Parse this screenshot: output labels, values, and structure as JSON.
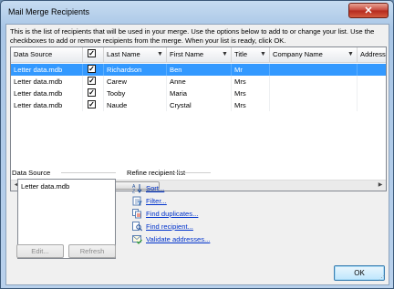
{
  "window": {
    "title": "Mail Merge Recipients",
    "close_glyph": "✕",
    "instructions": "This is the list of recipients that will be used in your merge. Use the options below to add to or change your list. Use the checkboxes to add or remove recipients from the merge. When your list is ready, click OK."
  },
  "grid": {
    "columns": [
      {
        "label": "Data Source",
        "has_dropdown": false
      },
      {
        "label": "",
        "header_checkbox": true
      },
      {
        "label": "Last Name",
        "has_dropdown": true
      },
      {
        "label": "First Name",
        "has_dropdown": true
      },
      {
        "label": "Title",
        "has_dropdown": true
      },
      {
        "label": "Company Name",
        "has_dropdown": true
      },
      {
        "label": "Address",
        "has_dropdown": false
      }
    ],
    "rows": [
      {
        "source": "Letter data.mdb",
        "checked": true,
        "last": "Richardson",
        "first": "Ben",
        "title": "Mr",
        "company": "",
        "selected": true
      },
      {
        "source": "Letter data.mdb",
        "checked": true,
        "last": "Carew",
        "first": "Anne",
        "title": "Mrs",
        "company": "",
        "selected": false
      },
      {
        "source": "Letter data.mdb",
        "checked": true,
        "last": "Tooby",
        "first": "Maria",
        "title": "Mrs",
        "company": "",
        "selected": false
      },
      {
        "source": "Letter data.mdb",
        "checked": true,
        "last": "Naude",
        "first": "Crystal",
        "title": "Mrs",
        "company": "",
        "selected": false
      }
    ]
  },
  "data_source": {
    "label": "Data Source",
    "items": [
      "Letter data.mdb"
    ],
    "edit_label": "Edit...",
    "refresh_label": "Refresh"
  },
  "refine": {
    "label": "Refine recipient list",
    "links": [
      {
        "label": "Sort...",
        "icon": "sort-icon"
      },
      {
        "label": "Filter...",
        "icon": "filter-icon"
      },
      {
        "label": "Find duplicates...",
        "icon": "find-duplicates-icon"
      },
      {
        "label": "Find recipient...",
        "icon": "find-recipient-icon"
      },
      {
        "label": "Validate addresses...",
        "icon": "validate-addresses-icon"
      }
    ]
  },
  "ok_label": "OK",
  "colors": {
    "selection": "#3399ff",
    "link": "#0033cc",
    "close_button": "#c4463a"
  }
}
